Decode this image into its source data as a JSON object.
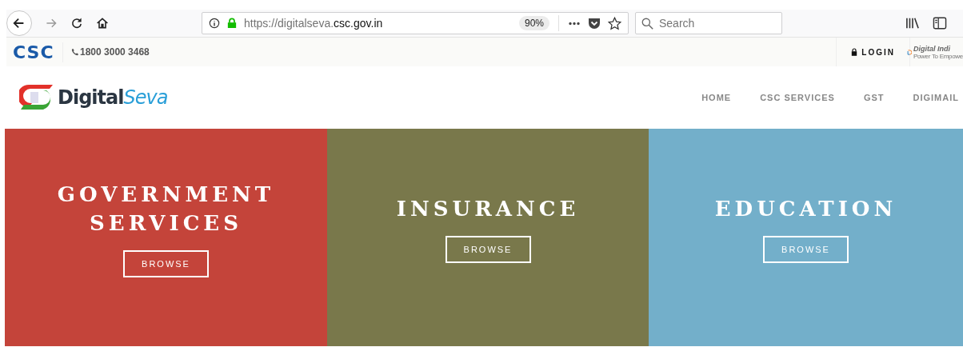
{
  "browser": {
    "url_prefix": "https://digitalseva.",
    "url_domain": "csc.gov.in",
    "zoom": "90%",
    "search": {
      "placeholder": "Search"
    }
  },
  "top_bar": {
    "logo": "CSC",
    "phone": "1800 3000 3468",
    "login": "LOGIN",
    "partner_logo": "Digital Indi",
    "partner_tagline": "Power To Empowe"
  },
  "header": {
    "brand_main": "Digital",
    "brand_accent": "Seva",
    "nav": [
      {
        "label": "HOME"
      },
      {
        "label": "CSC SERVICES"
      },
      {
        "label": "GST"
      },
      {
        "label": "DIGIMAIL"
      }
    ]
  },
  "panels": [
    {
      "title": "GOVERNMENT SERVICES",
      "button": "BROWSE",
      "color": "#c4443a"
    },
    {
      "title": "INSURANCE",
      "button": "BROWSE",
      "color": "#79784b"
    },
    {
      "title": "EDUCATION",
      "button": "BROWSE",
      "color": "#73afca"
    }
  ]
}
